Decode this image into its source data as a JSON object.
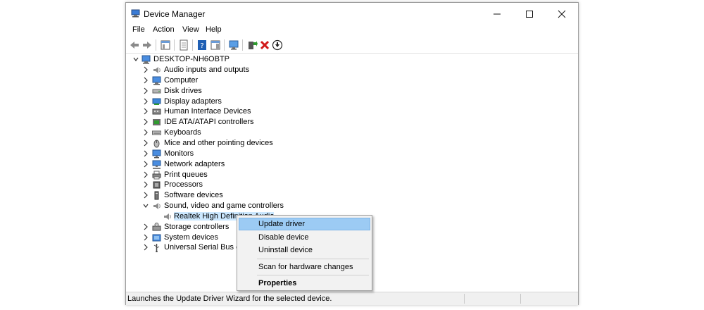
{
  "window": {
    "title": "Device Manager",
    "minimize": "—",
    "maximize": "☐",
    "close": "✕"
  },
  "menu": [
    "File",
    "Action",
    "View",
    "Help"
  ],
  "tree": {
    "root": "DESKTOP-NH6OBTP",
    "categories": [
      {
        "label": "Audio inputs and outputs",
        "icon": "speaker-icon"
      },
      {
        "label": "Computer",
        "icon": "computer-icon"
      },
      {
        "label": "Disk drives",
        "icon": "disk-drive-icon"
      },
      {
        "label": "Display adapters",
        "icon": "display-adapter-icon"
      },
      {
        "label": "Human Interface Devices",
        "icon": "hid-icon"
      },
      {
        "label": "IDE ATA/ATAPI controllers",
        "icon": "ide-controller-icon"
      },
      {
        "label": "Keyboards",
        "icon": "keyboard-icon"
      },
      {
        "label": "Mice and other pointing devices",
        "icon": "mouse-icon"
      },
      {
        "label": "Monitors",
        "icon": "monitor-icon"
      },
      {
        "label": "Network adapters",
        "icon": "network-adapter-icon"
      },
      {
        "label": "Print queues",
        "icon": "printer-icon"
      },
      {
        "label": "Processors",
        "icon": "processor-icon"
      },
      {
        "label": "Software devices",
        "icon": "software-device-icon"
      },
      {
        "label": "Sound, video and game controllers",
        "icon": "speaker-icon",
        "expanded": true
      },
      {
        "label": "Realtek High Definition Audio",
        "icon": "speaker-icon",
        "child": true
      },
      {
        "label": "Storage controllers",
        "icon": "storage-controller-icon"
      },
      {
        "label": "System devices",
        "icon": "system-device-icon"
      },
      {
        "label": "Universal Serial Bus cont",
        "icon": "usb-icon"
      }
    ]
  },
  "context_menu": {
    "update_driver": "Update driver",
    "disable_device": "Disable device",
    "uninstall_device": "Uninstall device",
    "scan_hardware": "Scan for hardware changes",
    "properties": "Properties"
  },
  "status": {
    "text": "Launches the Update Driver Wizard for the selected device."
  },
  "colors": {
    "highlight": "#9ccbf4",
    "accent_green": "#2e9b2e",
    "accent_red": "#d11a1a"
  }
}
